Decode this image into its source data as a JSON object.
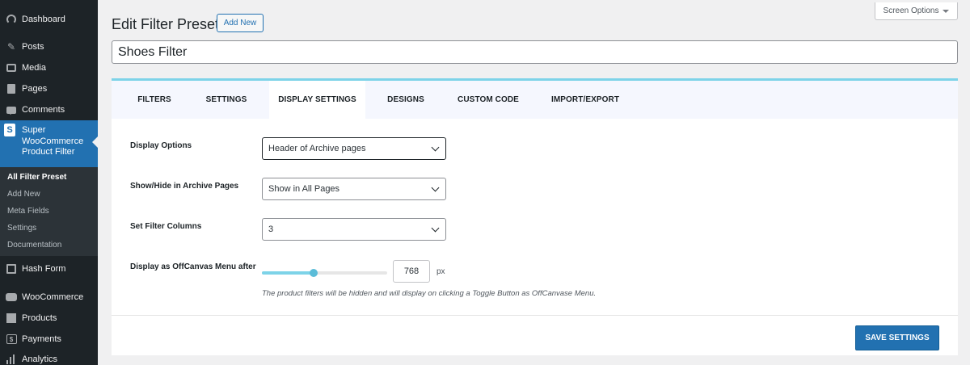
{
  "sidebar": {
    "items": [
      {
        "label": "Dashboard",
        "icon": "dashboard-icon"
      },
      {
        "label": "Posts",
        "icon": "pin-icon"
      },
      {
        "label": "Media",
        "icon": "media-icon"
      },
      {
        "label": "Pages",
        "icon": "page-icon"
      },
      {
        "label": "Comments",
        "icon": "comment-icon"
      }
    ],
    "plugin": {
      "label_line1": "Super",
      "label_line2": "WooCommerce",
      "label_line3": "Product Filter",
      "icon_letter": "S"
    },
    "submenu": [
      "All Filter Preset",
      "Add New",
      "Meta Fields",
      "Settings",
      "Documentation"
    ],
    "items_after": [
      {
        "label": "Hash Form",
        "icon": "form-icon"
      },
      {
        "label": "WooCommerce",
        "icon": "woo-icon"
      },
      {
        "label": "Products",
        "icon": "box-icon"
      },
      {
        "label": "Payments",
        "icon": "dollar-icon"
      },
      {
        "label": "Analytics",
        "icon": "bars-icon"
      }
    ],
    "payments_icon_glyph": "$"
  },
  "header": {
    "screen_options": "Screen Options",
    "title": "Edit Filter Preset",
    "add_new": "Add New",
    "preset_name": "Shoes Filter"
  },
  "tabs": [
    "FILTERS",
    "SETTINGS",
    "DISPLAY SETTINGS",
    "DESIGNS",
    "CUSTOM CODE",
    "IMPORT/EXPORT"
  ],
  "active_tab": "DISPLAY SETTINGS",
  "settings": {
    "display_options": {
      "label": "Display Options",
      "value": "Header of Archive pages"
    },
    "show_hide": {
      "label": "Show/Hide in Archive Pages",
      "value": "Show in All Pages"
    },
    "filter_columns": {
      "label": "Set Filter Columns",
      "value": "3"
    },
    "offcanvas": {
      "label": "Display as OffCanvas Menu after",
      "value": "768",
      "unit": "px",
      "slider_fraction": 0.41,
      "help": "The product filters will be hidden and will display on clicking a Toggle Button as OffCanvase Menu."
    }
  },
  "save_label": "SAVE SETTINGS",
  "colors": {
    "accent": "#2271b1",
    "tab_border": "#7dd3e8",
    "sidebar": "#1d2327"
  }
}
